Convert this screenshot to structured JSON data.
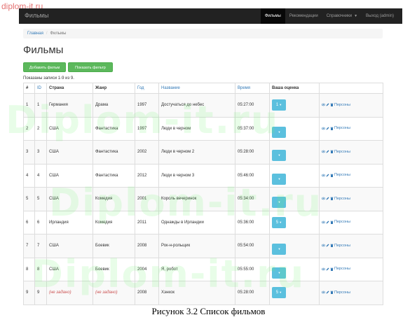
{
  "site_mark": "diplom-it.ru",
  "navbar": {
    "brand": "Фильмы",
    "items": [
      {
        "label": "Фильмы",
        "active": true
      },
      {
        "label": "Рекомендации",
        "active": false
      },
      {
        "label": "Справочники",
        "active": false,
        "dropdown": true
      },
      {
        "label": "Выход (admin)",
        "active": false
      }
    ]
  },
  "breadcrumb": {
    "home": "Главная",
    "separator": "/",
    "current": "Фильмы"
  },
  "page_title": "Фильмы",
  "buttons": {
    "add": "Добавить фильм",
    "filter": "Показать фильтр"
  },
  "summary": "Показаны записи 1-9 из 9.",
  "table": {
    "headers": [
      "#",
      "ID",
      "Страна",
      "Жанр",
      "Год",
      "Название",
      "Время",
      "Ваша оценка",
      ""
    ],
    "rows": [
      {
        "num": "1",
        "id": "1",
        "country": "Германия",
        "genre": "Драма",
        "year": "1997",
        "title": "Достучаться до небес",
        "time": "05:27:00",
        "rating": "1"
      },
      {
        "num": "2",
        "id": "2",
        "country": "США",
        "genre": "Фантастика",
        "year": "1997",
        "title": "Люди в черном",
        "time": "05:37:00",
        "rating": ""
      },
      {
        "num": "3",
        "id": "3",
        "country": "США",
        "genre": "Фантастика",
        "year": "2002",
        "title": "Люди в черном 2",
        "time": "05:28:00",
        "rating": ""
      },
      {
        "num": "4",
        "id": "4",
        "country": "США",
        "genre": "Фантастика",
        "year": "2012",
        "title": "Люди в черном 3",
        "time": "05:46:00",
        "rating": ""
      },
      {
        "num": "5",
        "id": "5",
        "country": "США",
        "genre": "Комедия",
        "year": "2001",
        "title": "Король вечеринок",
        "time": "05:34:00",
        "rating": ""
      },
      {
        "num": "6",
        "id": "6",
        "country": "Ирландия",
        "genre": "Комедия",
        "year": "2011",
        "title": "Однажды в Ирландии",
        "time": "05:36:00",
        "rating": "5"
      },
      {
        "num": "7",
        "id": "7",
        "country": "США",
        "genre": "Боевик",
        "year": "2008",
        "title": "Рок-н-рольщик",
        "time": "05:54:00",
        "rating": ""
      },
      {
        "num": "8",
        "id": "8",
        "country": "США",
        "genre": "Боевик",
        "year": "2004",
        "title": "Я, робот",
        "time": "05:55:00",
        "rating": ""
      },
      {
        "num": "9",
        "id": "9",
        "country": "(не задано)",
        "genre": "(не задано)",
        "year": "2008",
        "title": "Хэнкок",
        "time": "05:28:00",
        "rating": "5"
      }
    ],
    "persons_label": "Персоны"
  },
  "watermark": "Diplom-it.ru",
  "caption": "Рисунок 3.2  Список фильмов",
  "colors": {
    "navbar": "#222222",
    "success": "#5cb85c",
    "info": "#5bc0de",
    "link": "#337ab7",
    "watermark": "#6ef06e"
  }
}
